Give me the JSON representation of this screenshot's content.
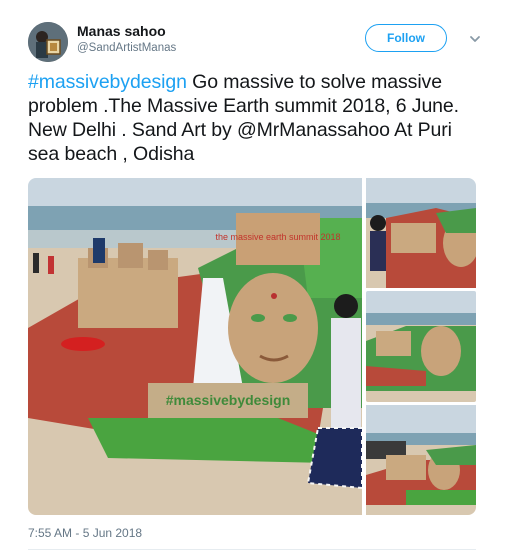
{
  "user": {
    "name": "Manas sahoo",
    "handle": "@SandArtistManas"
  },
  "follow_label": "Follow",
  "tweet": {
    "hashtag": "#massivebydesign",
    "text": " Go massive to solve massive problem .The Massive Earth summit 2018, 6 June. New Delhi . Sand  Art by @MrManassahoo At Puri sea beach , Odisha"
  },
  "media": {
    "sculpture_sign": "the massive earth summit 2018",
    "base_text": "#massivebydesign"
  },
  "timestamp": "7:55 AM - 5 Jun 2018",
  "colors": {
    "accent": "#1da1f2",
    "secondary_text": "#657786"
  }
}
